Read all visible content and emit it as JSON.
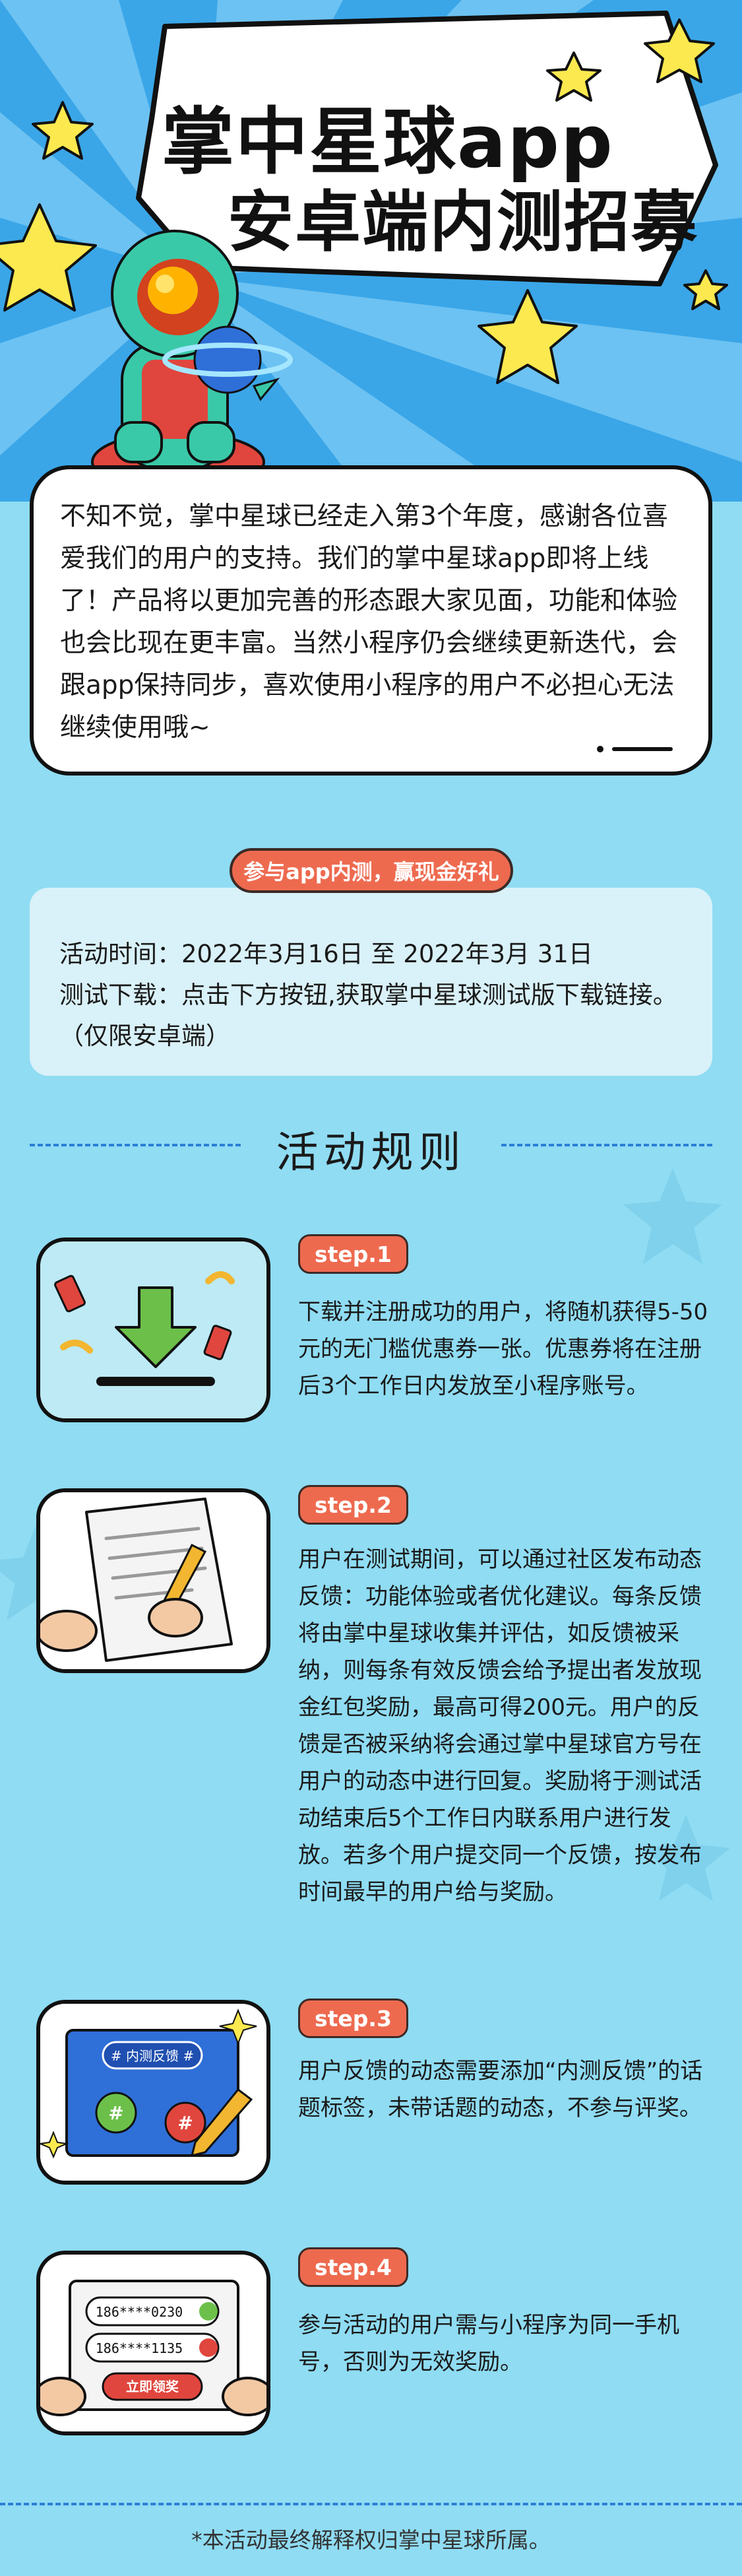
{
  "hero": {
    "title_line1": "掌中星球app",
    "title_line2": "安卓端内测招募"
  },
  "intro": {
    "text": "不知不觉，掌中星球已经走入第3个年度，感谢各位喜爱我们的用户的支持。我们的掌中星球app即将上线了！产品将以更加完善的形态跟大家见面，功能和体验也会比现在更丰富。当然小程序仍会继续更新迭代，会跟app保持同步，喜欢使用小程序的用户不必担心无法继续使用哦~"
  },
  "event": {
    "pill_label": "参与app内测，赢现金好礼",
    "time_label": "活动时间：",
    "time_value": "2022年3月16日 至 2022年3月 31日",
    "download_label": "测试下载：",
    "download_value": "点击下方按钮,获取掌中星球测试版下载链接。（仅限安卓端）"
  },
  "rules": {
    "title": "活动规则",
    "steps": [
      {
        "badge": "step.1",
        "text": "下载并注册成功的用户，将随机获得5-50元的无门槛优惠券一张。优惠券将在注册后3个工作日内发放至小程序账号。"
      },
      {
        "badge": "step.2",
        "text": "用户在测试期间，可以通过社区发布动态反馈：功能体验或者优化建议。每条反馈将由掌中星球收集并评估，如反馈被采纳，则每条有效反馈会给予提出者发放现金红包奖励，最高可得200元。用户的反馈是否被采纳将会通过掌中星球官方号在用户的动态中进行回复。奖励将于测试活动结束后5个工作日内联系用户进行发放。若多个用户提交同一个反馈，按发布时间最早的用户给与奖励。"
      },
      {
        "badge": "step.3",
        "text": "用户反馈的动态需要添加“内测反馈”的话题标签，未带话题的动态，不参与评奖。"
      },
      {
        "badge": "step.4",
        "text": "参与活动的用户需与小程序为同一手机号，否则为无效奖励。"
      }
    ]
  },
  "illustrations": {
    "step3_tag": "# 内测反馈 #",
    "step3_hash": "#",
    "step4_phone1": "186****0230",
    "step4_phone2": "186****1135",
    "step4_button": "立即领奖"
  },
  "footer": {
    "note": "*本活动最终解释权归掌中星球所属。"
  },
  "colors": {
    "accent": "#ee6a4f",
    "background": "#8fdcf3",
    "hero_blue": "#3aa6e8",
    "dash_blue": "#2b7fd6",
    "star_yellow": "#fbe94f"
  }
}
